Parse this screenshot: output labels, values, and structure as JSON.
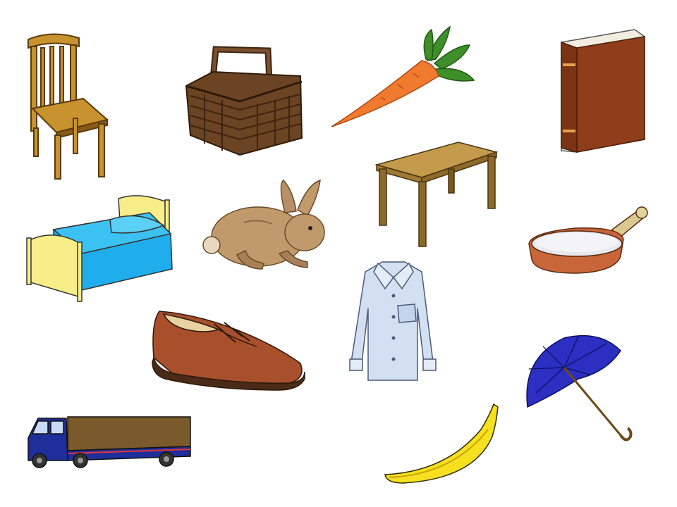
{
  "items": [
    {
      "id": "chair",
      "icon": "chair-icon",
      "colors": {
        "wood": "#C8922E",
        "dark": "#8A5A14"
      }
    },
    {
      "id": "basket",
      "icon": "basket-icon",
      "colors": {
        "weave": "#6B4423",
        "dark": "#3E2410"
      }
    },
    {
      "id": "carrot",
      "icon": "carrot-icon",
      "colors": {
        "root": "#F07A2E",
        "leaves": "#3E8E2A"
      }
    },
    {
      "id": "book",
      "icon": "book-icon",
      "colors": {
        "cover": "#8E3E1A",
        "spine_band": "#E8A04A"
      }
    },
    {
      "id": "bed",
      "icon": "bed-icon",
      "colors": {
        "frame": "#F7EE8A",
        "blanket": "#1FAEEB"
      }
    },
    {
      "id": "rabbit",
      "icon": "rabbit-icon",
      "colors": {
        "fur": "#C19A6B",
        "shade": "#8C6A45"
      }
    },
    {
      "id": "table",
      "icon": "table-icon",
      "colors": {
        "top": "#C49A4C",
        "legs": "#8E6A2A"
      }
    },
    {
      "id": "frying-pan",
      "icon": "frying-pan-icon",
      "colors": {
        "copper": "#C8663A",
        "inside": "#E8E8EC"
      }
    },
    {
      "id": "shirt",
      "icon": "shirt-icon",
      "colors": {
        "fabric": "#D2E0F2",
        "outline": "#4A5A78"
      }
    },
    {
      "id": "shoe",
      "icon": "shoe-icon",
      "colors": {
        "leather": "#A8502C",
        "sole": "#4A2A18"
      }
    },
    {
      "id": "umbrella",
      "icon": "umbrella-icon",
      "colors": {
        "canopy": "#2B2FC2",
        "handle": "#6B4A1A"
      }
    },
    {
      "id": "truck",
      "icon": "truck-icon",
      "colors": {
        "cab": "#1E2E9A",
        "cargo": "#7A5A2A"
      }
    },
    {
      "id": "banana",
      "icon": "banana-icon",
      "colors": {
        "peel": "#F6E020",
        "edge": "#C9A400"
      }
    }
  ]
}
